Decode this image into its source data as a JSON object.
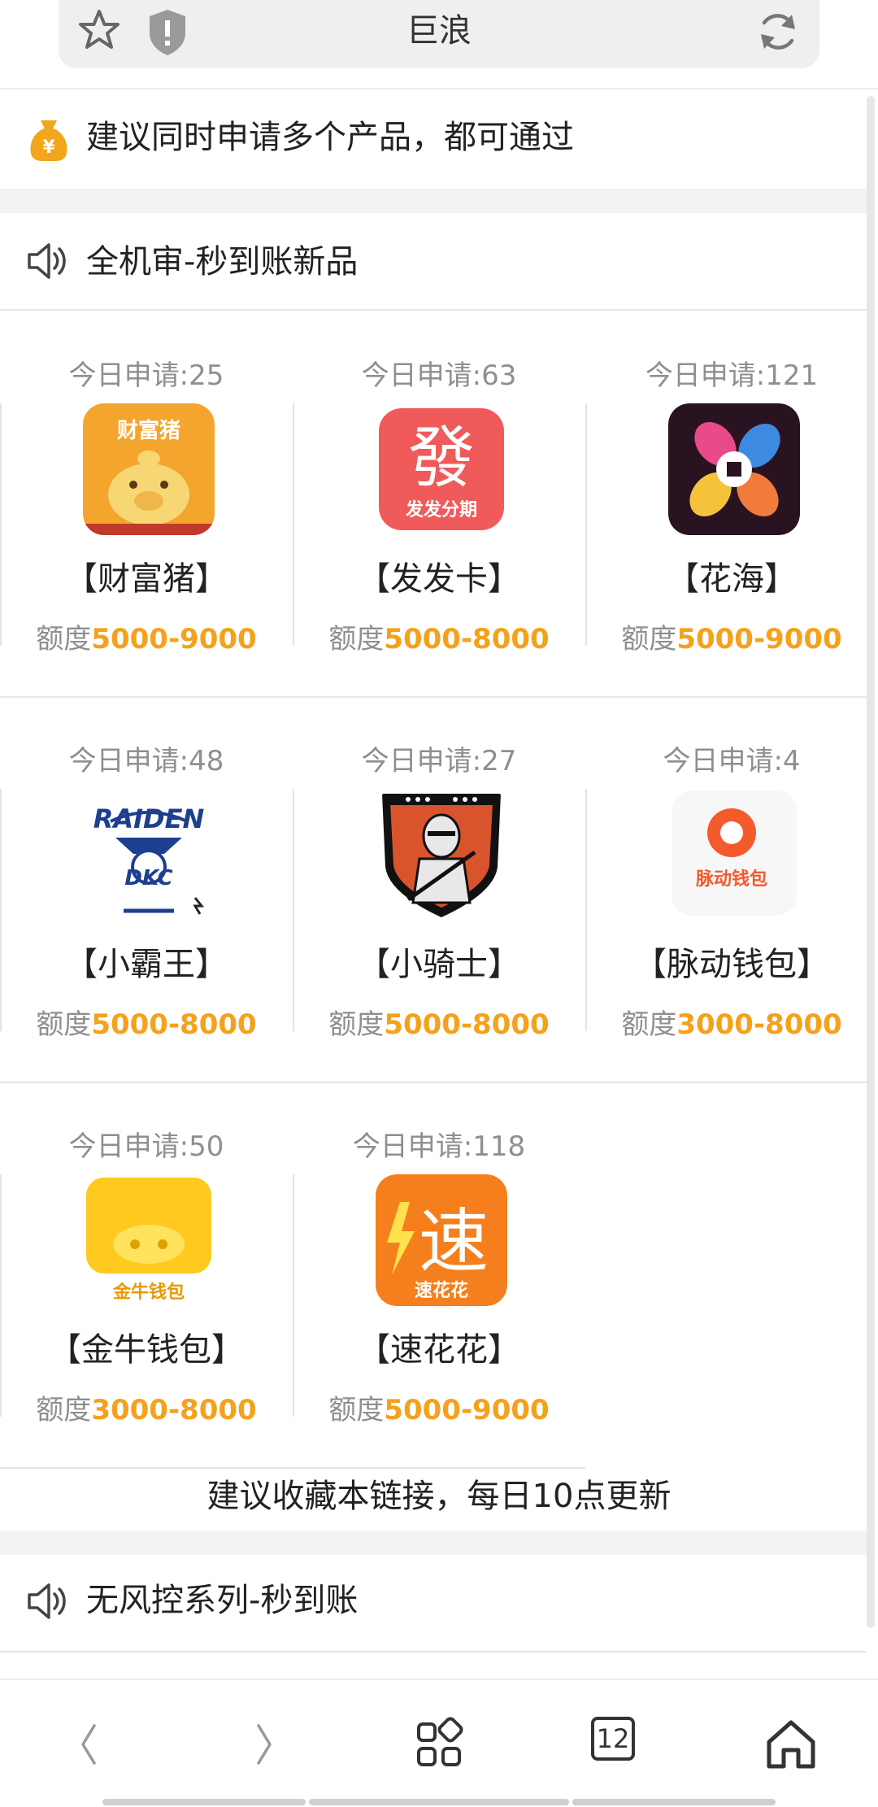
{
  "address_bar": {
    "title": "巨浪"
  },
  "notice": {
    "text": "建议同时申请多个产品，都可通过"
  },
  "section1": {
    "title": "全机审-秒到账新品"
  },
  "products": [
    {
      "count_label": "今日申请:25",
      "name": "【财富猪】",
      "quota_label": "额度",
      "quota_value": "5000-9000"
    },
    {
      "count_label": "今日申请:63",
      "name": "【发发卡】",
      "quota_label": "额度",
      "quota_value": "5000-8000"
    },
    {
      "count_label": "今日申请:121",
      "name": "【花海】",
      "quota_label": "额度",
      "quota_value": "5000-9000"
    },
    {
      "count_label": "今日申请:48",
      "name": "【小霸王】",
      "quota_label": "额度",
      "quota_value": "5000-8000"
    },
    {
      "count_label": "今日申请:27",
      "name": "【小骑士】",
      "quota_label": "额度",
      "quota_value": "5000-8000"
    },
    {
      "count_label": "今日申请:4",
      "name": "【脉动钱包】",
      "quota_label": "额度",
      "quota_value": "3000-8000"
    },
    {
      "count_label": "今日申请:50",
      "name": "【金牛钱包】",
      "quota_label": "额度",
      "quota_value": "3000-8000"
    },
    {
      "count_label": "今日申请:118",
      "name": "【速花花】",
      "quota_label": "额度",
      "quota_value": "5000-9000"
    }
  ],
  "logos": {
    "caifuzhu_text": "财富猪",
    "fafa_big": "發",
    "fafa_small": "发发分期",
    "xiaobawang_text": "RAIDEN",
    "xiaobawang_sub": "DKC",
    "maidong_text": "脉动钱包",
    "jinniu_text": "金牛钱包",
    "suhuahua_big": "速",
    "suhuahua_small": "速花花"
  },
  "tip": {
    "text": "建议收藏本链接，每日10点更新"
  },
  "section2": {
    "title": "无风控系列-秒到账"
  },
  "bottom_nav": {
    "tab_count": "12"
  },
  "colors": {
    "accent": "#f5a11c",
    "muted": "#8f8f8f"
  }
}
